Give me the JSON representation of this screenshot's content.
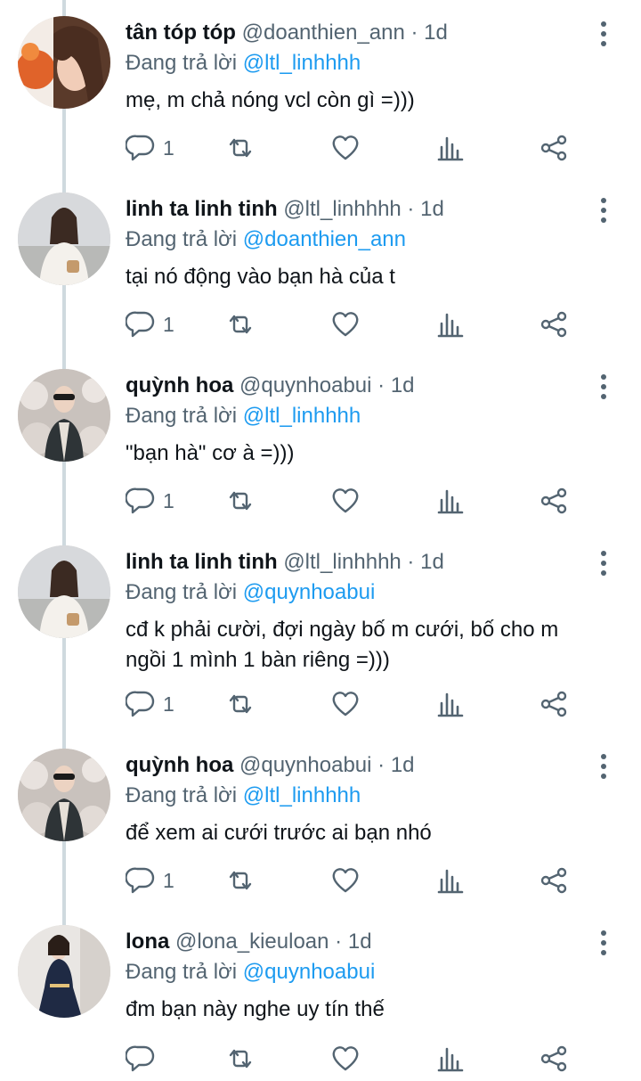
{
  "icons": {
    "reply": "reply-bubble-icon",
    "retweet": "retweet-icon",
    "like": "heart-icon",
    "views": "views-bar-icon",
    "share": "share-icon",
    "more": "more-dots-icon"
  },
  "colors": {
    "accent": "#1d9bf0",
    "muted": "#536471",
    "text": "#0f1419",
    "thread": "#cfd9de"
  },
  "tweets": [
    {
      "name": "tân tóp tóp",
      "handle": "@doanthien_ann",
      "sep": " · ",
      "time": "1d",
      "reply_prefix": "Đang trả lời",
      "reply_to": "@ltl_linhhhh",
      "lines": [
        "mẹ, m chả nóng vcl còn gì =)))"
      ],
      "reply_count": "1"
    },
    {
      "name": "linh ta linh tinh",
      "handle": "@ltl_linhhhh",
      "sep": " · ",
      "time": "1d",
      "reply_prefix": "Đang trả lời",
      "reply_to": "@doanthien_ann",
      "lines": [
        "tại nó động vào bạn hà của t"
      ],
      "reply_count": "1"
    },
    {
      "name": "quỳnh hoa",
      "handle": "@quynhoabui",
      "sep": " · ",
      "time": "1d",
      "reply_prefix": "Đang trả lời",
      "reply_to": "@ltl_linhhhh",
      "lines": [
        "\"bạn hà\" cơ à =)))"
      ],
      "reply_count": "1"
    },
    {
      "name": "linh ta linh tinh",
      "handle": "@ltl_linhhhh",
      "sep": " · ",
      "time": "1d",
      "reply_prefix": "Đang trả lời",
      "reply_to": "@quynhoabui",
      "lines": [
        "cđ k phải cười, đợi ngày bố m cưới, bố cho m",
        "ngồi 1 mình 1 bàn riêng =)))"
      ],
      "reply_count": "1"
    },
    {
      "name": "quỳnh hoa",
      "handle": "@quynhoabui",
      "sep": " · ",
      "time": "1d",
      "reply_prefix": "Đang trả lời",
      "reply_to": "@ltl_linhhhh",
      "lines": [
        "để xem ai cưới trước ai bạn nhó"
      ],
      "reply_count": "1"
    },
    {
      "name": "lona",
      "handle": "@lona_kieuloan",
      "sep": " · ",
      "time": "1d",
      "reply_prefix": "Đang trả lời",
      "reply_to": "@quynhoabui",
      "lines": [
        "đm bạn này nghe uy tín thế"
      ],
      "reply_count": ""
    }
  ]
}
